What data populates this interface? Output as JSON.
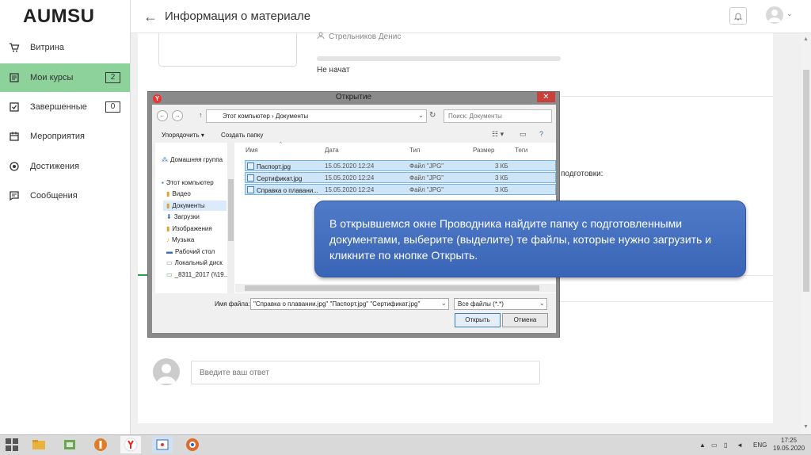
{
  "app": {
    "logo": "AUMSU"
  },
  "sidebar": {
    "items": [
      {
        "label": "Витрина",
        "icon": "cart-icon"
      },
      {
        "label": "Мои курсы",
        "icon": "courses-icon",
        "badge": "2",
        "active": true
      },
      {
        "label": "Завершенные",
        "icon": "check-icon",
        "badge": "0"
      },
      {
        "label": "Мероприятия",
        "icon": "calendar-icon"
      },
      {
        "label": "Достижения",
        "icon": "award-icon"
      },
      {
        "label": "Сообщения",
        "icon": "messages-icon"
      }
    ]
  },
  "header": {
    "title": "Информация о материале",
    "back_icon": "arrow-left-icon"
  },
  "material": {
    "author": "Стрельников Денис",
    "status": "Не начат",
    "prep_text": "подготовки:",
    "progress": 0
  },
  "reply": {
    "placeholder": "Введите ваш ответ"
  },
  "dialog": {
    "title": "Открытие",
    "path": [
      "Этот компьютер",
      "Документы"
    ],
    "search_placeholder": "Поиск: Документы",
    "toolbar": {
      "organize": "Упорядочить ▾",
      "new_folder": "Создать папку"
    },
    "tree": [
      "Домашняя группа",
      "Этот компьютер",
      "Видео",
      "Документы",
      "Загрузки",
      "Изображения",
      "Музыка",
      "Рабочий стол",
      "Локальный диск",
      "_8311_2017 (\\\\19..."
    ],
    "columns": [
      "Имя",
      "Дата",
      "Тип",
      "Размер",
      "Теги"
    ],
    "files": [
      {
        "name": "Паспорт.jpg",
        "date": "15.05.2020 12:24",
        "type": "Файл \"JPG\"",
        "size": "3 КБ"
      },
      {
        "name": "Сертификат.jpg",
        "date": "15.05.2020 12:24",
        "type": "Файл \"JPG\"",
        "size": "3 КБ"
      },
      {
        "name": "Справка о плавани...",
        "date": "15.05.2020 12:24",
        "type": "Файл \"JPG\"",
        "size": "3 КБ"
      }
    ],
    "filename_label": "Имя файла:",
    "filename_value": "\"Справка о плавании.jpg\" \"Паспорт.jpg\" \"Сертификат.jpg\"",
    "filetype": "Все файлы (*.*)",
    "open_button": "Открыть",
    "cancel_button": "Отмена"
  },
  "callout": {
    "text": "В открывшемся окне Проводника найдите папку с подготовленными документами, выберите (выделите)  те файлы, которые нужно загрузить и кликните по кнопке Открыть."
  },
  "taskbar": {
    "lang": "ENG",
    "time": "17:25",
    "date": "19.05.2020"
  }
}
